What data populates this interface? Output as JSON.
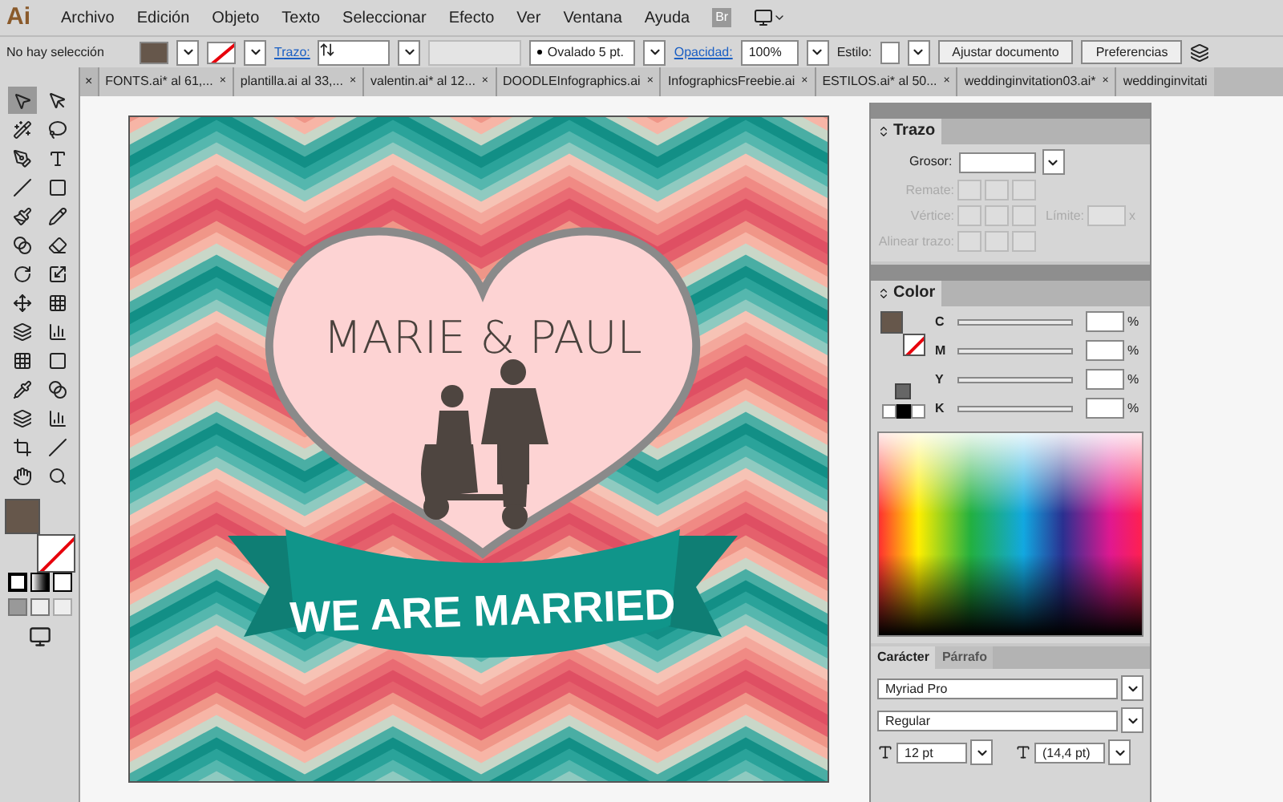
{
  "app": {
    "logo": "Ai",
    "bridge": "Br"
  },
  "menu": [
    "Archivo",
    "Edición",
    "Objeto",
    "Texto",
    "Seleccionar",
    "Efecto",
    "Ver",
    "Ventana",
    "Ayuda"
  ],
  "control_bar": {
    "selection": "No hay selección",
    "stroke_label": "Trazo:",
    "brush": "Ovalado 5 pt.",
    "opacity_label": "Opacidad:",
    "opacity": "100%",
    "style_label": "Estilo:",
    "buttons": [
      "Ajustar documento",
      "Preferencias"
    ]
  },
  "tabs_leading_close": "×",
  "tabs": [
    {
      "label": "FONTS.ai* al 61,...",
      "close": "×",
      "selected": false
    },
    {
      "label": "plantilla.ai al 33,...",
      "close": "×",
      "selected": false
    },
    {
      "label": "valentin.ai* al 12...",
      "close": "×",
      "selected": false
    },
    {
      "label": "DOODLEInfographics.ai",
      "close": "×",
      "selected": false
    },
    {
      "label": "InfographicsFreebie.ai",
      "close": "×",
      "selected": false
    },
    {
      "label": "ESTILOS.ai* al 50...",
      "close": "×",
      "selected": false
    },
    {
      "label": "weddinginvitation03.ai*",
      "close": "×",
      "selected": false
    },
    {
      "label": "weddinginvitati",
      "selected": false
    }
  ],
  "artwork": {
    "names": "MARIE & PAUL",
    "banner": "WE ARE MARRIED"
  },
  "stroke_panel": {
    "title": "Trazo",
    "weight_label": "Grosor:",
    "rows": [
      {
        "label": "Remate:",
        "disabled": true
      },
      {
        "label": "Vértice:",
        "disabled": true
      },
      {
        "label": "Alinear trazo:",
        "disabled": true
      }
    ],
    "limit_label": "Límite:",
    "limit_unit": "x"
  },
  "color_panel": {
    "title": "Color",
    "channels": [
      {
        "name": "C",
        "unit": "%",
        "level": 0
      },
      {
        "name": "M",
        "unit": "%",
        "level": 0
      },
      {
        "name": "Y",
        "unit": "%",
        "level": 0
      },
      {
        "name": "K",
        "unit": "%",
        "level": 0
      }
    ]
  },
  "character_panel": {
    "tabs": [
      {
        "label": "Carácter",
        "selected": true
      },
      {
        "label": "Párrafo",
        "selected": false
      }
    ],
    "font": "Myriad Pro",
    "style": "Regular",
    "size": "12 pt",
    "leading": "(14,4 pt)"
  }
}
